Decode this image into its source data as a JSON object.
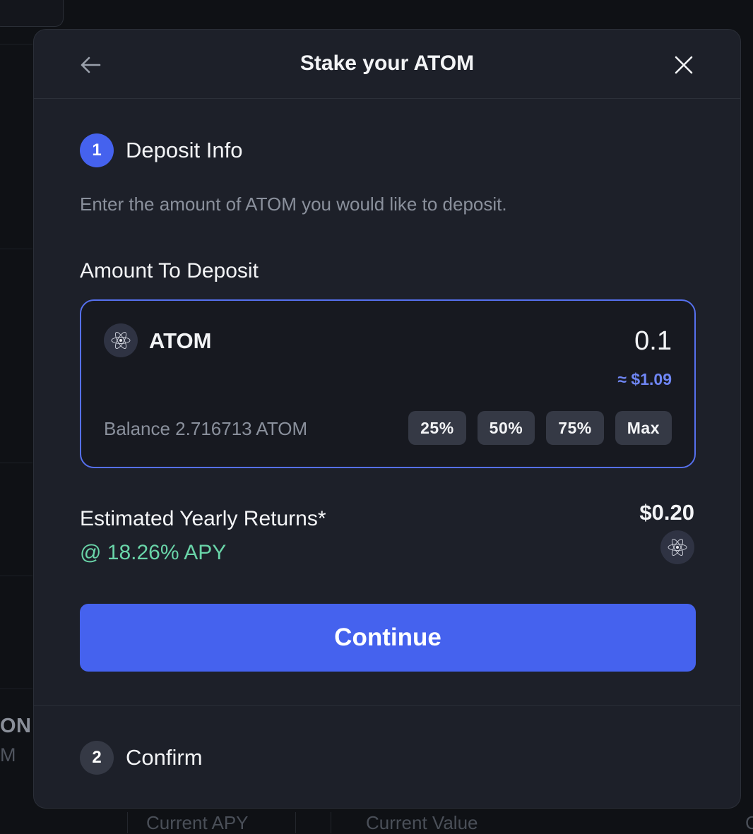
{
  "background": {
    "left_text_top": "ON",
    "left_text_bottom": "M",
    "footer_labels": [
      "Current APY",
      "Current Value",
      "C"
    ]
  },
  "modal": {
    "title": "Stake your ATOM",
    "back_icon": "arrow-left-icon",
    "close_icon": "close-icon"
  },
  "step1": {
    "number": "1",
    "label": "Deposit Info",
    "description": "Enter the amount of ATOM you would like to deposit."
  },
  "amount": {
    "label": "Amount To Deposit",
    "token_symbol": "ATOM",
    "token_icon": "cosmos-atom-icon",
    "value": "0.1",
    "usd_estimate": "≈ $1.09",
    "balance": "Balance 2.716713 ATOM",
    "percent_buttons": [
      "25%",
      "50%",
      "75%",
      "Max"
    ]
  },
  "returns": {
    "label": "Estimated Yearly Returns*",
    "apy": "@ 18.26% APY",
    "value": "$0.20"
  },
  "continue_label": "Continue",
  "step2": {
    "number": "2",
    "label": "Confirm"
  },
  "colors": {
    "accent": "#4562ee",
    "apy_green": "#69d4a8",
    "usd_blue": "#6f86f4",
    "modal_bg": "#1d2029"
  }
}
